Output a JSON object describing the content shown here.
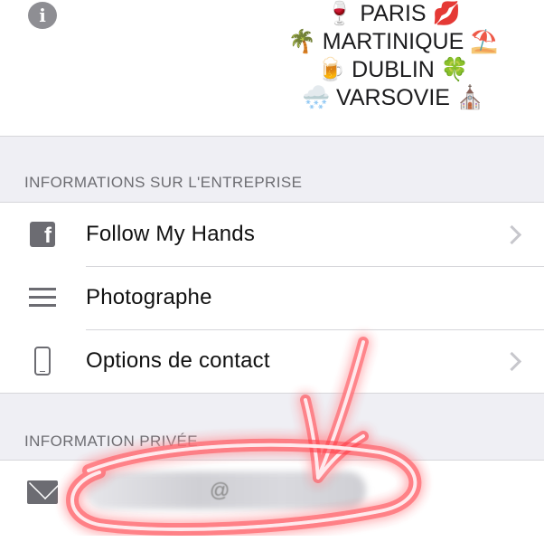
{
  "top": {
    "info_icon_glyph": "i",
    "bio_lines": [
      "🍷 PARIS 💋",
      "🌴 MARTINIQUE ⛱️",
      "🍺 DUBLIN 🍀",
      "🌨️ VARSOVIE ⛪"
    ]
  },
  "company_section": {
    "header": "INFORMATIONS SUR L'ENTREPRISE",
    "items": [
      {
        "label": "Follow My Hands",
        "icon": "facebook-icon",
        "has_chevron": true
      },
      {
        "label": "Photographe",
        "icon": "list-icon",
        "has_chevron": false
      },
      {
        "label": "Options de contact",
        "icon": "phone-icon",
        "has_chevron": true
      }
    ]
  },
  "private_section": {
    "header": "INFORMATION PRIVÉE",
    "email_visible_fragment": "@",
    "email_icon": "mail-icon"
  },
  "colors": {
    "background": "#efeff4",
    "icon_gray": "#6c6c72",
    "header_gray": "#6d6d72",
    "chevron": "#c7c7cc",
    "annotation": "#ff2a3a"
  }
}
